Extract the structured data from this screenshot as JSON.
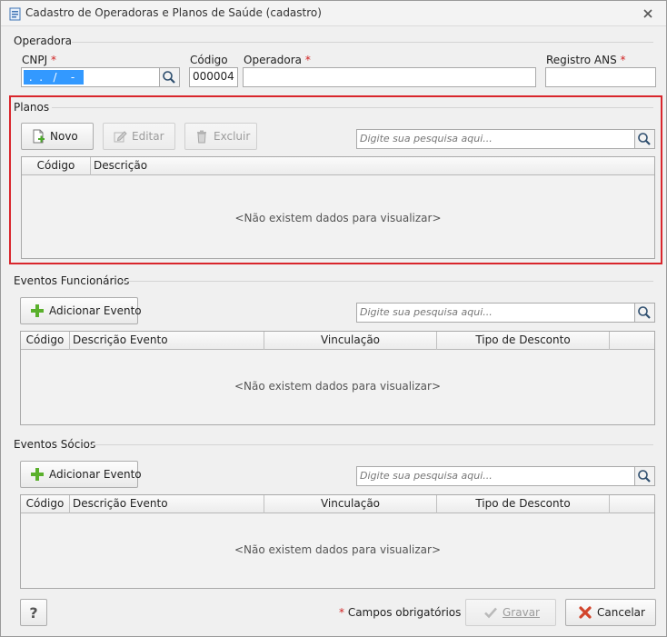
{
  "window": {
    "title": "Cadastro de Operadoras e Planos de Saúde (cadastro)"
  },
  "operadora_section": {
    "label": "Operadora",
    "cnpj": {
      "label": "CNPJ",
      "required": "*",
      "value": " .  .   /    -  "
    },
    "codigo": {
      "label": "Código",
      "value": "000004"
    },
    "operadora": {
      "label": "Operadora",
      "required": "*",
      "value": ""
    },
    "registro_ans": {
      "label": "Registro ANS",
      "required": "*",
      "value": ""
    }
  },
  "planos_section": {
    "label": "Planos",
    "buttons": {
      "novo": "Novo",
      "editar": "Editar",
      "excluir": "Excluir"
    },
    "search_placeholder": "Digite sua pesquisa aqui...",
    "columns": [
      "Código",
      "Descrição"
    ],
    "empty_message": "<Não existem dados para visualizar>"
  },
  "eventos_funcionarios": {
    "label": "Eventos Funcionários",
    "add_button": "Adicionar Evento",
    "search_placeholder": "Digite sua pesquisa aqui...",
    "columns": [
      "Código",
      "Descrição Evento",
      "Vinculação",
      "Tipo de Desconto"
    ],
    "empty_message": "<Não existem dados para visualizar>"
  },
  "eventos_socios": {
    "label": "Eventos Sócios",
    "add_button": "Adicionar Evento",
    "search_placeholder": "Digite sua pesquisa aqui...",
    "columns": [
      "Código",
      "Descrição Evento",
      "Vinculação",
      "Tipo de Desconto"
    ],
    "empty_message": "<Não existem dados para visualizar>"
  },
  "footer": {
    "help": "?",
    "required_mark": "*",
    "required_note": "Campos obrigatórios",
    "gravar": "Gravar",
    "cancelar": "Cancelar"
  },
  "colors": {
    "highlight": "#d9262c",
    "selection": "#3399ff",
    "required": "#d02020"
  },
  "icons": [
    "form-icon",
    "close-icon",
    "search-icon",
    "new-document-icon",
    "edit-icon",
    "trash-icon",
    "plus-icon",
    "check-icon",
    "cancel-x-icon"
  ]
}
